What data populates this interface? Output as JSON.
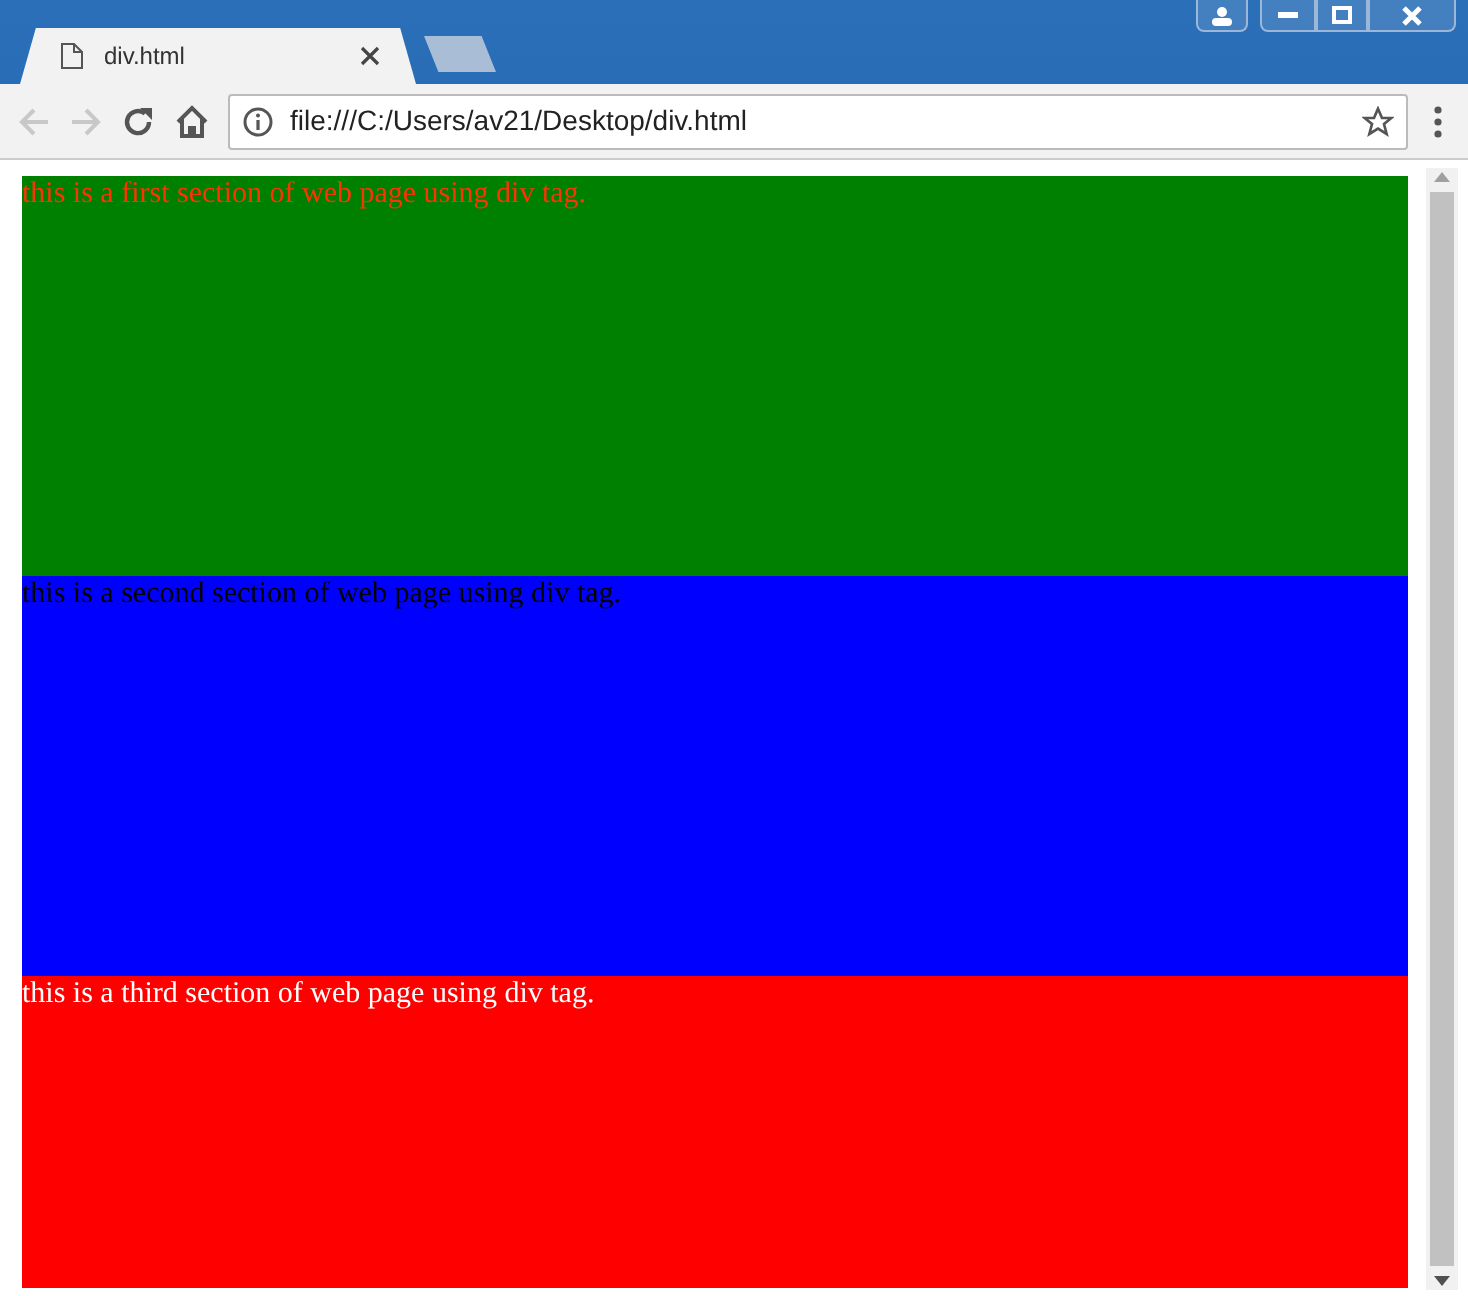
{
  "tabs": [
    {
      "title": "div.html",
      "selected": true
    }
  ],
  "address": "file:///C:/Users/av21/Desktop/div.html",
  "nav": {
    "back_disabled": true,
    "forward_disabled": true
  },
  "sections": [
    {
      "text": "this is a first section of web page using div tag.",
      "kind": "accent",
      "color": "#008000"
    },
    {
      "text": "this is a second section of web page using div tag.",
      "kind": "dark",
      "color": "#0000ff"
    },
    {
      "text": "this is a third section of web page using div tag.",
      "kind": "light",
      "color": "#ff0000"
    }
  ]
}
